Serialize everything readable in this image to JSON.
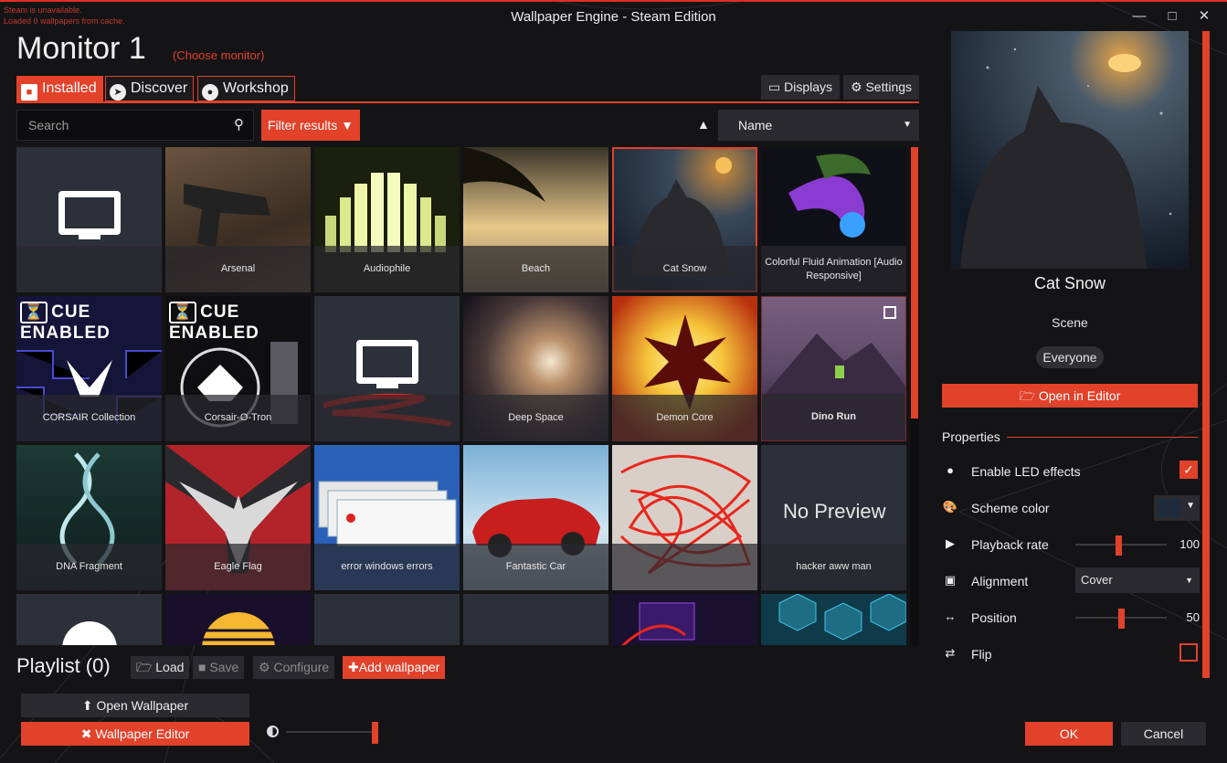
{
  "window": {
    "title": "Wallpaper Engine - Steam Edition",
    "notices": [
      "Steam is unavailable.",
      "Loaded 0 wallpapers from cache."
    ]
  },
  "header": {
    "monitor_title": "Monitor 1",
    "choose_monitor": "(Choose monitor)"
  },
  "tabs": [
    {
      "label": "Installed",
      "icon": "save-icon",
      "active": true
    },
    {
      "label": "Discover",
      "icon": "compass-icon"
    },
    {
      "label": "Workshop",
      "icon": "steam-icon"
    }
  ],
  "toolbar": {
    "displays": "Displays",
    "settings": "Settings"
  },
  "search": {
    "placeholder": "Search"
  },
  "filter": {
    "label": "Filter results"
  },
  "sort": {
    "value": "Name",
    "direction": "ascending"
  },
  "tiles": [
    {
      "title": "",
      "art": "monitor"
    },
    {
      "title": "Arsenal",
      "art": "arsenal"
    },
    {
      "title": "Audiophile",
      "art": "audiophile"
    },
    {
      "title": "Beach",
      "art": "beach"
    },
    {
      "title": "Cat Snow",
      "art": "catsnow",
      "selected": true
    },
    {
      "title": "Colorful Fluid Animation [Audio Responsive]",
      "art": "fluid"
    },
    {
      "title": "CORSAIR Collection",
      "art": "corsair",
      "badge": "CUE ENABLED"
    },
    {
      "title": "Corsair-O-Tron",
      "art": "corsairtron",
      "badge": "CUE ENABLED"
    },
    {
      "title": "",
      "art": "monitor-scribbled"
    },
    {
      "title": "Deep Space",
      "art": "space"
    },
    {
      "title": "Demon Core",
      "art": "demon"
    },
    {
      "title": "Dino Run",
      "art": "dino",
      "checkbox": true
    },
    {
      "title": "DNA Fragment",
      "art": "dna"
    },
    {
      "title": "Eagle Flag",
      "art": "eagle"
    },
    {
      "title": "error windows errors",
      "art": "errors"
    },
    {
      "title": "Fantastic Car",
      "art": "car"
    },
    {
      "title": "",
      "art": "scribbled"
    },
    {
      "title": "hacker aww man",
      "art": "nopreview",
      "overlay": "No Preview"
    },
    {
      "title": "",
      "art": "partial-dark"
    },
    {
      "title": "",
      "art": "partial-sunset"
    },
    {
      "title": "",
      "art": "partial-empty"
    },
    {
      "title": "",
      "art": "partial-empty"
    },
    {
      "title": "",
      "art": "partial-neon"
    },
    {
      "title": "",
      "art": "partial-hex"
    }
  ],
  "playlist": {
    "title": "Playlist (0)",
    "load": "Load",
    "save": "Save",
    "configure": "Configure",
    "add": "Add wallpaper"
  },
  "bottom": {
    "open_wallpaper": "Open Wallpaper",
    "wallpaper_editor": "Wallpaper Editor",
    "brightness": 1.0
  },
  "details": {
    "title": "Cat Snow",
    "type": "Scene",
    "rating": "Everyone",
    "open_editor": "Open in Editor",
    "properties_heading": "Properties",
    "properties": {
      "led": {
        "label": "Enable LED effects",
        "icon": "bulb-icon",
        "checked": true
      },
      "scheme": {
        "label": "Scheme color",
        "icon": "palette-icon",
        "color": "#1e2b3c"
      },
      "playback": {
        "label": "Playback rate",
        "icon": "play-icon",
        "value": "100",
        "fraction": 0.47
      },
      "alignment": {
        "label": "Alignment",
        "icon": "image-icon",
        "value": "Cover"
      },
      "position": {
        "label": "Position",
        "icon": "arrows-horizontal-icon",
        "value": "50",
        "fraction": 0.5
      },
      "flip": {
        "label": "Flip",
        "icon": "swap-icon",
        "checked": false
      }
    }
  },
  "dialog": {
    "ok": "OK",
    "cancel": "Cancel"
  },
  "colors": {
    "accent": "#e2412a",
    "background": "#141417",
    "panel": "#2b2b2f"
  }
}
